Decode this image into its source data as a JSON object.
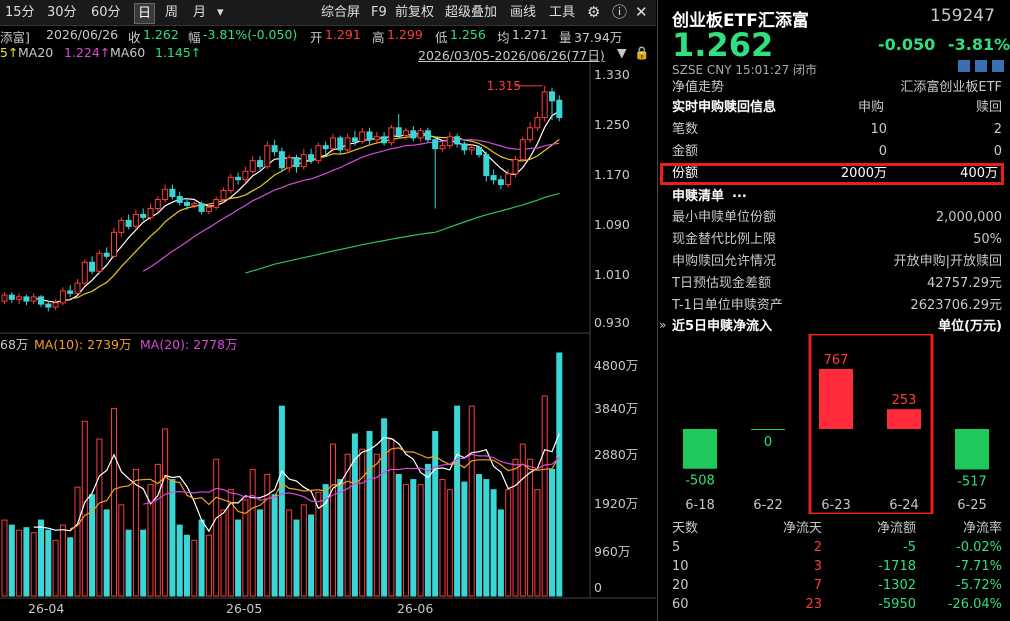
{
  "toolbar": {
    "periods": [
      "15分",
      "30分",
      "60分",
      "日",
      "周",
      "月"
    ],
    "active_period": "日",
    "more": "▾",
    "items": [
      "综合屏",
      "F9",
      "前复权",
      "超级叠加",
      "画线",
      "工具"
    ]
  },
  "chart_header": {
    "name": "添富]",
    "date": "2026/06/26",
    "close_label": "收",
    "close": "1.262",
    "change_label": "幅",
    "change": "-3.81%(-0.050)",
    "open_label": "开",
    "open": "1.291",
    "high_label": "高",
    "high": "1.299",
    "low_label": "低",
    "low": "1.256",
    "avg_label": "均",
    "avg": "1.271",
    "vol_label": "量",
    "vol": "37.94万"
  },
  "ma_line": {
    "ma5_tail": "5↑",
    "ma20": "MA20",
    "ma20_val": "1.224↑",
    "ma60": "MA60",
    "ma60_val": "1.145↑",
    "range": "2026/03/05-2026/06/26(77日)"
  },
  "vol_header": {
    "vol_tail": "68万",
    "ma10": "MA(10): 2739万",
    "ma20": "MA(20): 2778万"
  },
  "price_axis": [
    "1.330",
    "1.250",
    "1.170",
    "1.090",
    "1.010",
    "0.930"
  ],
  "vol_axis": [
    "4800万",
    "3840万",
    "2880万",
    "1920万",
    "960万",
    "0"
  ],
  "date_axis": [
    "26-04",
    "26-05",
    "26-06"
  ],
  "peak_label": "1.315",
  "chart_data": {
    "type": "candlestick",
    "ylim": [
      0.915,
      1.345
    ],
    "vol_ylim": [
      0,
      4800
    ],
    "candles": [
      {
        "o": 0.955,
        "c": 0.965,
        "h": 0.97,
        "l": 0.95,
        "v": 1500
      },
      {
        "o": 0.965,
        "c": 0.958,
        "h": 0.97,
        "l": 0.952,
        "v": 1400
      },
      {
        "o": 0.958,
        "c": 0.962,
        "h": 0.968,
        "l": 0.95,
        "v": 1300
      },
      {
        "o": 0.962,
        "c": 0.955,
        "h": 0.966,
        "l": 0.948,
        "v": 1350
      },
      {
        "o": 0.955,
        "c": 0.962,
        "h": 0.968,
        "l": 0.95,
        "v": 1250
      },
      {
        "o": 0.962,
        "c": 0.95,
        "h": 0.965,
        "l": 0.945,
        "v": 1500
      },
      {
        "o": 0.95,
        "c": 0.945,
        "h": 0.955,
        "l": 0.938,
        "v": 1300
      },
      {
        "o": 0.945,
        "c": 0.952,
        "h": 0.958,
        "l": 0.94,
        "v": 1100
      },
      {
        "o": 0.952,
        "c": 0.972,
        "h": 0.978,
        "l": 0.948,
        "v": 1400
      },
      {
        "o": 0.972,
        "c": 0.968,
        "h": 0.982,
        "l": 0.962,
        "v": 1150
      },
      {
        "o": 0.968,
        "c": 0.985,
        "h": 0.992,
        "l": 0.965,
        "v": 2150
      },
      {
        "o": 0.985,
        "c": 1.02,
        "h": 1.025,
        "l": 0.982,
        "v": 3450
      },
      {
        "o": 1.02,
        "c": 1.005,
        "h": 1.03,
        "l": 1.0,
        "v": 2000
      },
      {
        "o": 1.005,
        "c": 1.035,
        "h": 1.04,
        "l": 1.002,
        "v": 3100
      },
      {
        "o": 1.035,
        "c": 1.03,
        "h": 1.045,
        "l": 1.025,
        "v": 1700
      },
      {
        "o": 1.03,
        "c": 1.07,
        "h": 1.078,
        "l": 1.028,
        "v": 3700
      },
      {
        "o": 1.07,
        "c": 1.09,
        "h": 1.095,
        "l": 1.062,
        "v": 1800
      },
      {
        "o": 1.09,
        "c": 1.08,
        "h": 1.1,
        "l": 1.075,
        "v": 1300
      },
      {
        "o": 1.08,
        "c": 1.1,
        "h": 1.108,
        "l": 1.075,
        "v": 2500
      },
      {
        "o": 1.1,
        "c": 1.095,
        "h": 1.11,
        "l": 1.09,
        "v": 1300
      },
      {
        "o": 1.095,
        "c": 1.11,
        "h": 1.118,
        "l": 1.09,
        "v": 2200
      },
      {
        "o": 1.11,
        "c": 1.125,
        "h": 1.13,
        "l": 1.105,
        "v": 2600
      },
      {
        "o": 1.125,
        "c": 1.142,
        "h": 1.15,
        "l": 1.12,
        "v": 3300
      },
      {
        "o": 1.142,
        "c": 1.13,
        "h": 1.15,
        "l": 1.125,
        "v": 2300
      },
      {
        "o": 1.13,
        "c": 1.12,
        "h": 1.138,
        "l": 1.115,
        "v": 1400
      },
      {
        "o": 1.12,
        "c": 1.115,
        "h": 1.128,
        "l": 1.108,
        "v": 1200
      },
      {
        "o": 1.115,
        "c": 1.118,
        "h": 1.122,
        "l": 1.11,
        "v": 1100
      },
      {
        "o": 1.118,
        "c": 1.105,
        "h": 1.122,
        "l": 1.1,
        "v": 1500
      },
      {
        "o": 1.105,
        "c": 1.112,
        "h": 1.118,
        "l": 1.1,
        "v": 1200
      },
      {
        "o": 1.112,
        "c": 1.125,
        "h": 1.13,
        "l": 1.108,
        "v": 2700
      },
      {
        "o": 1.125,
        "c": 1.14,
        "h": 1.145,
        "l": 1.12,
        "v": 1700
      },
      {
        "o": 1.14,
        "c": 1.162,
        "h": 1.168,
        "l": 1.135,
        "v": 2100
      },
      {
        "o": 1.162,
        "c": 1.158,
        "h": 1.17,
        "l": 1.15,
        "v": 1500
      },
      {
        "o": 1.158,
        "c": 1.172,
        "h": 1.18,
        "l": 1.152,
        "v": 1900
      },
      {
        "o": 1.172,
        "c": 1.19,
        "h": 1.198,
        "l": 1.168,
        "v": 2500
      },
      {
        "o": 1.19,
        "c": 1.18,
        "h": 1.198,
        "l": 1.175,
        "v": 1700
      },
      {
        "o": 1.18,
        "c": 1.215,
        "h": 1.222,
        "l": 1.176,
        "v": 2400
      },
      {
        "o": 1.215,
        "c": 1.205,
        "h": 1.225,
        "l": 1.198,
        "v": 2000
      },
      {
        "o": 1.205,
        "c": 1.178,
        "h": 1.212,
        "l": 1.172,
        "v": 3750
      },
      {
        "o": 1.178,
        "c": 1.195,
        "h": 1.2,
        "l": 1.17,
        "v": 1700
      },
      {
        "o": 1.195,
        "c": 1.18,
        "h": 1.2,
        "l": 1.17,
        "v": 1500
      },
      {
        "o": 1.18,
        "c": 1.2,
        "h": 1.21,
        "l": 1.175,
        "v": 1800
      },
      {
        "o": 1.2,
        "c": 1.19,
        "h": 1.21,
        "l": 1.185,
        "v": 1600
      },
      {
        "o": 1.19,
        "c": 1.215,
        "h": 1.22,
        "l": 1.185,
        "v": 2050
      },
      {
        "o": 1.215,
        "c": 1.21,
        "h": 1.222,
        "l": 1.2,
        "v": 2200
      },
      {
        "o": 1.21,
        "c": 1.228,
        "h": 1.235,
        "l": 1.205,
        "v": 3000
      },
      {
        "o": 1.228,
        "c": 1.208,
        "h": 1.232,
        "l": 1.2,
        "v": 2300
      },
      {
        "o": 1.208,
        "c": 1.228,
        "h": 1.235,
        "l": 1.202,
        "v": 2800
      },
      {
        "o": 1.228,
        "c": 1.222,
        "h": 1.24,
        "l": 1.215,
        "v": 3200
      },
      {
        "o": 1.222,
        "c": 1.238,
        "h": 1.245,
        "l": 1.218,
        "v": 2900
      },
      {
        "o": 1.238,
        "c": 1.225,
        "h": 1.245,
        "l": 1.218,
        "v": 3250
      },
      {
        "o": 1.225,
        "c": 1.23,
        "h": 1.238,
        "l": 1.22,
        "v": 2800
      },
      {
        "o": 1.23,
        "c": 1.22,
        "h": 1.238,
        "l": 1.215,
        "v": 3500
      },
      {
        "o": 1.22,
        "c": 1.245,
        "h": 1.25,
        "l": 1.215,
        "v": 3100
      },
      {
        "o": 1.245,
        "c": 1.232,
        "h": 1.268,
        "l": 1.228,
        "v": 2400
      },
      {
        "o": 1.232,
        "c": 1.24,
        "h": 1.245,
        "l": 1.225,
        "v": 2200
      },
      {
        "o": 1.24,
        "c": 1.228,
        "h": 1.248,
        "l": 1.222,
        "v": 2300
      },
      {
        "o": 1.228,
        "c": 1.24,
        "h": 1.245,
        "l": 1.222,
        "v": 2200
      },
      {
        "o": 1.24,
        "c": 1.225,
        "h": 1.245,
        "l": 1.22,
        "v": 2600
      },
      {
        "o": 1.225,
        "c": 1.21,
        "h": 1.23,
        "l": 1.11,
        "v": 3250
      },
      {
        "o": 1.21,
        "c": 1.215,
        "h": 1.222,
        "l": 1.205,
        "v": 2300
      },
      {
        "o": 1.215,
        "c": 1.23,
        "h": 1.238,
        "l": 1.21,
        "v": 2100
      },
      {
        "o": 1.23,
        "c": 1.218,
        "h": 1.235,
        "l": 1.212,
        "v": 3750
      },
      {
        "o": 1.218,
        "c": 1.208,
        "h": 1.222,
        "l": 1.2,
        "v": 2250
      },
      {
        "o": 1.208,
        "c": 1.212,
        "h": 1.218,
        "l": 1.2,
        "v": 3750
      },
      {
        "o": 1.212,
        "c": 1.2,
        "h": 1.215,
        "l": 1.195,
        "v": 2400
      },
      {
        "o": 1.2,
        "c": 1.165,
        "h": 1.205,
        "l": 1.155,
        "v": 2300
      },
      {
        "o": 1.165,
        "c": 1.158,
        "h": 1.175,
        "l": 1.15,
        "v": 2100
      },
      {
        "o": 1.158,
        "c": 1.15,
        "h": 1.165,
        "l": 1.142,
        "v": 1700
      },
      {
        "o": 1.15,
        "c": 1.168,
        "h": 1.175,
        "l": 1.145,
        "v": 2100
      },
      {
        "o": 1.168,
        "c": 1.192,
        "h": 1.198,
        "l": 1.162,
        "v": 2700
      },
      {
        "o": 1.192,
        "c": 1.225,
        "h": 1.23,
        "l": 1.188,
        "v": 3000
      },
      {
        "o": 1.225,
        "c": 1.245,
        "h": 1.255,
        "l": 1.22,
        "v": 2700
      },
      {
        "o": 1.245,
        "c": 1.262,
        "h": 1.272,
        "l": 1.24,
        "v": 2100
      },
      {
        "o": 1.262,
        "c": 1.305,
        "h": 1.315,
        "l": 1.255,
        "v": 3950
      },
      {
        "o": 1.305,
        "c": 1.29,
        "h": 1.312,
        "l": 1.258,
        "v": 2500
      },
      {
        "o": 1.291,
        "c": 1.262,
        "h": 1.299,
        "l": 1.256,
        "v": 4800
      }
    ]
  },
  "right": {
    "title": "创业板ETF汇添富",
    "code": "159247",
    "price": "1.262",
    "change": "-0.050",
    "change_pct": "-3.81%",
    "market": "SZSE CNY 15:01:27 闭市",
    "nav_trend": "净值走势",
    "nav_name": "汇添富创业板ETF",
    "sub_header": {
      "label": "实时申购赎回信息",
      "col1": "申购",
      "col2": "赎回"
    },
    "rows_sub": [
      {
        "label": "笔数",
        "v1": "10",
        "v2": "2"
      },
      {
        "label": "金额",
        "v1": "0",
        "v2": "0"
      },
      {
        "label": "份额",
        "v1": "2000万",
        "v2": "400万"
      }
    ],
    "list_title": "申赎清单",
    "more": "...",
    "list_rows": [
      {
        "label": "最小申赎单位份额",
        "value": "2,000,000"
      },
      {
        "label": "现金替代比例上限",
        "value": "50%"
      },
      {
        "label": "申购赎回允许情况",
        "value": "开放申购|开放赎回"
      },
      {
        "label": "T日预估现金差额",
        "value": "42757.29元"
      },
      {
        "label": "T-1日单位申赎资产",
        "value": "2623706.29元"
      }
    ],
    "flow_title": "近5日申赎净流入",
    "flow_unit": "单位(万元)",
    "flow": [
      {
        "date": "6-18",
        "value": -508
      },
      {
        "date": "6-22",
        "value": 0
      },
      {
        "date": "6-23",
        "value": 767
      },
      {
        "date": "6-24",
        "value": 253
      },
      {
        "date": "6-25",
        "value": -517
      }
    ],
    "stats_header": [
      "天数",
      "净流天",
      "净流额",
      "净流率"
    ],
    "stats": [
      {
        "days": "5",
        "flow_days": "2",
        "amount": "-5",
        "rate": "-0.02%"
      },
      {
        "days": "10",
        "flow_days": "3",
        "amount": "-1718",
        "rate": "-7.71%"
      },
      {
        "days": "20",
        "flow_days": "7",
        "amount": "-1302",
        "rate": "-5.72%"
      },
      {
        "days": "60",
        "flow_days": "23",
        "amount": "-5950",
        "rate": "-26.04%"
      }
    ]
  }
}
